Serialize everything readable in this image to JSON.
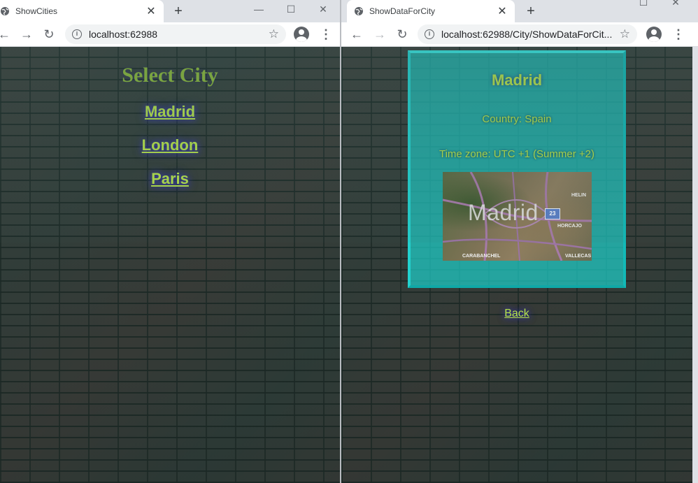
{
  "left": {
    "tab_title": "ShowCities",
    "url": "localhost:62988",
    "page_title": "Select City",
    "cities": [
      "Madrid",
      "London",
      "Paris"
    ]
  },
  "right": {
    "tab_title": "ShowDataForCity",
    "url": "localhost:62988/City/ShowDataForCit...",
    "city_name": "Madrid",
    "country_line": "Country: Spain",
    "timezone_line": "Time zone: UTC +1 (Summer +2)",
    "map": {
      "label": "Madrid",
      "shield": "23",
      "places": [
        "HELIN",
        "HORCAJO",
        "CARABANCHEL",
        "VALLECAS"
      ]
    },
    "back_label": "Back"
  },
  "chrome": {
    "new_tab_glyph": "+",
    "close_glyph": "✕",
    "back_glyph": "←",
    "forward_glyph": "→",
    "reload_glyph": "↻",
    "star_glyph": "☆",
    "kebab_glyph": "⋮",
    "minimize_glyph": "—",
    "maximize_glyph": "☐",
    "window_close_glyph": "✕",
    "info_glyph": "i"
  },
  "colors": {
    "link": "#b5e24a",
    "heading": "#8bb83a",
    "card": "#22d2cf"
  }
}
